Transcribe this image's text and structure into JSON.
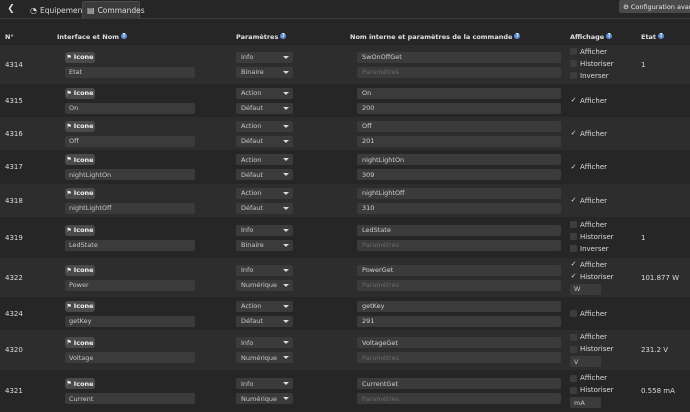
{
  "topbar": {
    "tabs": [
      {
        "label": "Equipement",
        "icon": "gauge-icon"
      },
      {
        "label": "Commandes",
        "icon": "list-icon"
      }
    ],
    "config_button": "Configuration avancée"
  },
  "headers": {
    "num": "N°",
    "interface": "Interface et Nom",
    "params": "Paramètres",
    "internal": "Nom interne et paramètres de la commande",
    "display": "Affichage",
    "state": "Etat"
  },
  "labels": {
    "icon_button": "Icone",
    "afficher": "Afficher",
    "historiser": "Historiser",
    "inverser": "Inverser",
    "param_placeholder": "Paramètres"
  },
  "rows": [
    {
      "id": "4314",
      "name": "Etat",
      "type": "Info",
      "subtype": "Binaire",
      "logical": "SwOnOffGet",
      "param": "",
      "afficher": false,
      "historiser": false,
      "inverser": false,
      "unit": "",
      "state": "1"
    },
    {
      "id": "4315",
      "name": "On",
      "type": "Action",
      "subtype": "Défaut",
      "logical": "On",
      "param": "200",
      "afficher": true,
      "state": ""
    },
    {
      "id": "4316",
      "name": "Off",
      "type": "Action",
      "subtype": "Défaut",
      "logical": "Off",
      "param": "201",
      "afficher": true,
      "state": ""
    },
    {
      "id": "4317",
      "name": "nightLightOn",
      "type": "Action",
      "subtype": "Défaut",
      "logical": "nightLightOn",
      "param": "309",
      "afficher": true,
      "state": ""
    },
    {
      "id": "4318",
      "name": "nightLightOff",
      "type": "Action",
      "subtype": "Défaut",
      "logical": "nightLightOff",
      "param": "310",
      "afficher": true,
      "state": ""
    },
    {
      "id": "4319",
      "name": "LedState",
      "type": "Info",
      "subtype": "Binaire",
      "logical": "LedState",
      "param": "",
      "afficher": false,
      "historiser": false,
      "inverser": false,
      "unit": "",
      "state": "1"
    },
    {
      "id": "4322",
      "name": "Power",
      "type": "Info",
      "subtype": "Numérique",
      "logical": "PowerGet",
      "param": "",
      "afficher": true,
      "historiser": true,
      "unit": "W",
      "state": "101.877 W"
    },
    {
      "id": "4324",
      "name": "getKey",
      "type": "Action",
      "subtype": "Défaut",
      "logical": "getKey",
      "param": "291",
      "afficher": false,
      "state": ""
    },
    {
      "id": "4320",
      "name": "Voltage",
      "type": "Info",
      "subtype": "Numérique",
      "logical": "VoltageGet",
      "param": "",
      "afficher": false,
      "historiser": false,
      "unit": "V",
      "state": "231.2 V"
    },
    {
      "id": "4321",
      "name": "Current",
      "type": "Info",
      "subtype": "Numérique",
      "logical": "CurrentGet",
      "param": "",
      "afficher": false,
      "historiser": false,
      "unit": "mA",
      "state": "0.558 mA"
    }
  ]
}
